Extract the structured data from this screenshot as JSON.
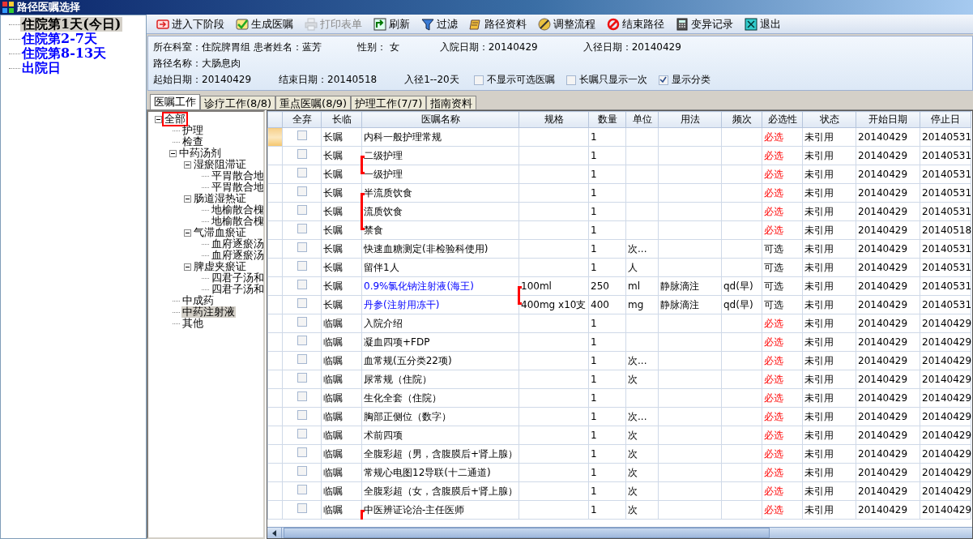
{
  "window": {
    "title": "路径医嘱选择"
  },
  "days": [
    {
      "label": "住院第1天(今日)",
      "selected": true
    },
    {
      "label": "住院第2-7天",
      "selected": false
    },
    {
      "label": "住院第8-13天",
      "selected": false
    },
    {
      "label": "出院日",
      "selected": false
    }
  ],
  "toolbar": [
    {
      "label": "进入下阶段",
      "disabled": false
    },
    {
      "label": "生成医嘱",
      "disabled": false
    },
    {
      "label": "打印表单",
      "disabled": true
    },
    {
      "label": "刷新",
      "disabled": false
    },
    {
      "label": "过滤",
      "disabled": false
    },
    {
      "label": "路径资料",
      "disabled": false
    },
    {
      "label": "调整流程",
      "disabled": false
    },
    {
      "label": "结束路径",
      "disabled": false
    },
    {
      "label": "变异记录",
      "disabled": false
    },
    {
      "label": "退出",
      "disabled": false
    }
  ],
  "info": {
    "line1": [
      "所在科室：住院脾胃组 患者姓名：蓝芳",
      "性别： 女",
      "入院日期：20140429",
      "入径日期：20140429"
    ],
    "line2": [
      "路径名称：大肠息肉"
    ],
    "line3": [
      "起始日期：20140429",
      "结束日期：20140518",
      "入径1--20天"
    ],
    "options": [
      {
        "label": "不显示可选医嘱",
        "checked": false
      },
      {
        "label": "长嘱只显示一次",
        "checked": false
      },
      {
        "label": "显示分类",
        "checked": true
      }
    ]
  },
  "tabs": [
    {
      "label": "医嘱工作",
      "selected": true
    },
    {
      "label": "诊疗工作(8/8)",
      "selected": false
    },
    {
      "label": "重点医嘱(8/9)",
      "selected": false
    },
    {
      "label": "护理工作(7/7)",
      "selected": false
    },
    {
      "label": "指南资料",
      "selected": false
    }
  ],
  "categories": [
    {
      "label": "全部",
      "selected": false,
      "outlined": true,
      "expanded": true,
      "children": [
        {
          "label": "护理",
          "selected": false
        },
        {
          "label": "检查",
          "selected": false
        },
        {
          "label": "中药汤剂",
          "selected": false,
          "expanded": true,
          "children": [
            {
              "label": "湿瘀阻滞证",
              "selected": false,
              "expanded": true,
              "children": [
                {
                  "label": "平胃散合地",
                  "selected": false
                },
                {
                  "label": "平胃散合地",
                  "selected": false
                }
              ]
            },
            {
              "label": "肠道湿热证",
              "selected": false,
              "expanded": true,
              "children": [
                {
                  "label": "地榆散合槐",
                  "selected": false
                },
                {
                  "label": "地榆散合槐",
                  "selected": false
                }
              ]
            },
            {
              "label": "气滞血瘀证",
              "selected": false,
              "expanded": true,
              "children": [
                {
                  "label": "血府逐瘀汤",
                  "selected": false
                },
                {
                  "label": "血府逐瘀汤",
                  "selected": false
                }
              ]
            },
            {
              "label": "脾虚夹瘀证",
              "selected": false,
              "expanded": true,
              "children": [
                {
                  "label": "四君子汤和",
                  "selected": false
                },
                {
                  "label": "四君子汤和",
                  "selected": false
                }
              ]
            }
          ]
        },
        {
          "label": "中成药",
          "selected": false
        },
        {
          "label": "中药注射液",
          "selected": true
        },
        {
          "label": "其他",
          "selected": false
        }
      ]
    }
  ],
  "table": {
    "columns": [
      "全弃",
      "长临",
      "医嘱名称",
      "规格",
      "数量",
      "单位",
      "用法",
      "频次",
      "必选性",
      "状态",
      "开始日期",
      "停止日"
    ],
    "rows": [
      {
        "current": true,
        "discarded": false,
        "type": "长嘱",
        "name": "内科一般护理常规",
        "spec": "",
        "qty": "1",
        "unit": "",
        "usage": "",
        "freq": "",
        "required": true,
        "necessity": "必选",
        "status": "未引用",
        "start": "20140429",
        "stop": "20140531"
      },
      {
        "current": false,
        "discarded": false,
        "type": "长嘱",
        "name": "二级护理",
        "name_bracket_top": true,
        "spec": "",
        "qty": "1",
        "unit": "",
        "usage": "",
        "freq": "",
        "required": true,
        "necessity": "必选",
        "status": "未引用",
        "start": "20140429",
        "stop": "20140531"
      },
      {
        "current": false,
        "discarded": false,
        "type": "长嘱",
        "name": "一级护理",
        "name_bracket_bottom": true,
        "spec": "",
        "qty": "1",
        "unit": "",
        "usage": "",
        "freq": "",
        "required": true,
        "necessity": "必选",
        "status": "未引用",
        "start": "20140429",
        "stop": "20140531"
      },
      {
        "current": false,
        "discarded": false,
        "type": "长嘱",
        "name": "半流质饮食",
        "name_bracket_top": true,
        "spec": "",
        "qty": "1",
        "unit": "",
        "usage": "",
        "freq": "",
        "required": true,
        "necessity": "必选",
        "status": "未引用",
        "start": "20140429",
        "stop": "20140531"
      },
      {
        "current": false,
        "discarded": false,
        "type": "长嘱",
        "name": "流质饮食",
        "name_bracket_middle": true,
        "spec": "",
        "qty": "1",
        "unit": "",
        "usage": "",
        "freq": "",
        "required": true,
        "necessity": "必选",
        "status": "未引用",
        "start": "20140429",
        "stop": "20140531"
      },
      {
        "current": false,
        "discarded": false,
        "type": "长嘱",
        "name": "禁食",
        "name_bracket_bottom": true,
        "spec": "",
        "qty": "1",
        "unit": "",
        "usage": "",
        "freq": "",
        "required": true,
        "necessity": "必选",
        "status": "未引用",
        "start": "20140429",
        "stop": "20140518"
      },
      {
        "current": false,
        "discarded": false,
        "type": "长嘱",
        "name": "快速血糖测定(非检验科使用)",
        "spec": "",
        "qty": "1",
        "unit": "次...",
        "usage": "",
        "freq": "",
        "required": false,
        "necessity": "可选",
        "status": "未引用",
        "start": "20140429",
        "stop": "20140531"
      },
      {
        "current": false,
        "discarded": false,
        "type": "长嘱",
        "name": "留伴1人",
        "spec": "",
        "qty": "1",
        "unit": "人",
        "usage": "",
        "freq": "",
        "required": false,
        "necessity": "可选",
        "status": "未引用",
        "start": "20140429",
        "stop": "20140531"
      },
      {
        "current": false,
        "discarded": false,
        "type": "长嘱",
        "name": "0.9%氯化钠注射液(海王)",
        "drug": true,
        "spec": "100ml",
        "spec_bracket_top": true,
        "qty": "250",
        "unit": "ml",
        "usage": "静脉滴注",
        "freq": "qd(早)",
        "required": false,
        "necessity": "可选",
        "status": "未引用",
        "start": "20140429",
        "stop": "20140531"
      },
      {
        "current": false,
        "discarded": false,
        "type": "长嘱",
        "name": "丹参(注射用冻干)",
        "drug": true,
        "spec": "400mg x10支",
        "spec_bracket_bottom": true,
        "qty": "400",
        "unit": "mg",
        "usage": "静脉滴注",
        "freq": "qd(早)",
        "required": false,
        "necessity": "可选",
        "status": "未引用",
        "start": "20140429",
        "stop": "20140531"
      },
      {
        "current": false,
        "discarded": false,
        "type": "临嘱",
        "name": "入院介绍",
        "spec": "",
        "qty": "1",
        "unit": "",
        "usage": "",
        "freq": "",
        "required": true,
        "necessity": "必选",
        "status": "未引用",
        "start": "20140429",
        "stop": "20140429"
      },
      {
        "current": false,
        "discarded": false,
        "type": "临嘱",
        "name": "凝血四项+FDP",
        "spec": "",
        "qty": "1",
        "unit": "",
        "usage": "",
        "freq": "",
        "required": true,
        "necessity": "必选",
        "status": "未引用",
        "start": "20140429",
        "stop": "20140429"
      },
      {
        "current": false,
        "discarded": false,
        "type": "临嘱",
        "name": "血常规(五分类22项)",
        "spec": "",
        "qty": "1",
        "unit": "次...",
        "usage": "",
        "freq": "",
        "required": true,
        "necessity": "必选",
        "status": "未引用",
        "start": "20140429",
        "stop": "20140429"
      },
      {
        "current": false,
        "discarded": false,
        "type": "临嘱",
        "name": "尿常规（住院）",
        "spec": "",
        "qty": "1",
        "unit": "次",
        "usage": "",
        "freq": "",
        "required": true,
        "necessity": "必选",
        "status": "未引用",
        "start": "20140429",
        "stop": "20140429"
      },
      {
        "current": false,
        "discarded": false,
        "type": "临嘱",
        "name": "生化全套（住院）",
        "spec": "",
        "qty": "1",
        "unit": "",
        "usage": "",
        "freq": "",
        "required": true,
        "necessity": "必选",
        "status": "未引用",
        "start": "20140429",
        "stop": "20140429"
      },
      {
        "current": false,
        "discarded": false,
        "type": "临嘱",
        "name": "胸部正侧位（数字）",
        "spec": "",
        "qty": "1",
        "unit": "次...",
        "usage": "",
        "freq": "",
        "required": true,
        "necessity": "必选",
        "status": "未引用",
        "start": "20140429",
        "stop": "20140429"
      },
      {
        "current": false,
        "discarded": false,
        "type": "临嘱",
        "name": "术前四项",
        "spec": "",
        "qty": "1",
        "unit": "次",
        "usage": "",
        "freq": "",
        "required": true,
        "necessity": "必选",
        "status": "未引用",
        "start": "20140429",
        "stop": "20140429"
      },
      {
        "current": false,
        "discarded": false,
        "type": "临嘱",
        "name": "全腹彩超（男，含腹膜后+肾上腺）",
        "spec": "",
        "qty": "1",
        "unit": "次",
        "usage": "",
        "freq": "",
        "required": true,
        "necessity": "必选",
        "status": "未引用",
        "start": "20140429",
        "stop": "20140429"
      },
      {
        "current": false,
        "discarded": false,
        "type": "临嘱",
        "name": "常规心电图12导联(十二通道)",
        "spec": "",
        "qty": "1",
        "unit": "次",
        "usage": "",
        "freq": "",
        "required": true,
        "necessity": "必选",
        "status": "未引用",
        "start": "20140429",
        "stop": "20140429"
      },
      {
        "current": false,
        "discarded": false,
        "type": "临嘱",
        "name": "全腹彩超（女，含腹膜后+肾上腺）",
        "spec": "",
        "qty": "1",
        "unit": "次",
        "usage": "",
        "freq": "",
        "required": true,
        "necessity": "必选",
        "status": "未引用",
        "start": "20140429",
        "stop": "20140429"
      },
      {
        "current": false,
        "discarded": false,
        "type": "临嘱",
        "name": "中医辨证论治-主任医师",
        "name_bracket_top": true,
        "spec": "",
        "qty": "1",
        "unit": "次",
        "usage": "",
        "freq": "",
        "required": true,
        "necessity": "必选",
        "status": "未引用",
        "start": "20140429",
        "stop": "20140429"
      }
    ]
  }
}
